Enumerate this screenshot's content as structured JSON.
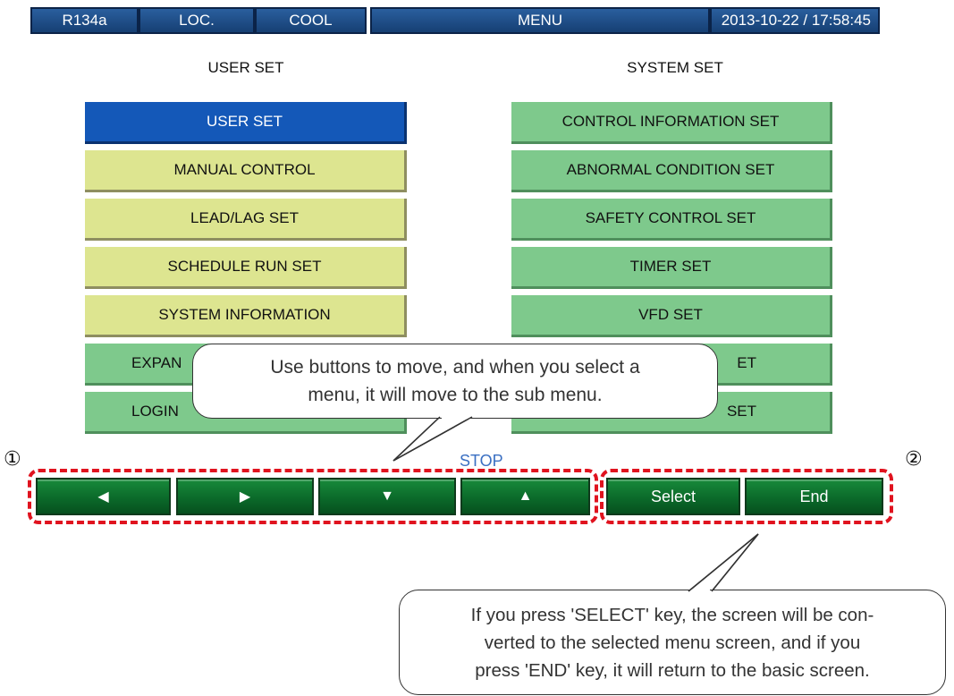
{
  "header": {
    "refrigerant": "R134a",
    "location": "LOC.",
    "mode": "COOL",
    "screen": "MENU",
    "datetime": "2013-10-22 / 17:58:45"
  },
  "user_set": {
    "title": "USER SET",
    "items": [
      {
        "label": "USER SET"
      },
      {
        "label": "MANUAL CONTROL"
      },
      {
        "label": "LEAD/LAG SET"
      },
      {
        "label": "SCHEDULE RUN SET"
      },
      {
        "label": "SYSTEM INFORMATION"
      },
      {
        "label": "EXPAN"
      },
      {
        "label": "LOGIN"
      }
    ]
  },
  "system_set": {
    "title": "SYSTEM SET",
    "items": [
      {
        "label": "CONTROL INFORMATION SET"
      },
      {
        "label": "ABNORMAL CONDITION SET"
      },
      {
        "label": "SAFETY CONTROL SET"
      },
      {
        "label": "TIMER SET"
      },
      {
        "label": "VFD SET"
      },
      {
        "label": "ET"
      },
      {
        "label": "SET"
      }
    ]
  },
  "status": "STOP",
  "keys": {
    "left": "◀",
    "right": "▶",
    "down": "▼",
    "up": "▲",
    "select": "Select",
    "end": "End"
  },
  "markers": {
    "one": "①",
    "two": "②"
  },
  "callouts": {
    "nav": {
      "line1": "Use buttons to move, and when you select a",
      "line2": "menu, it will move to the sub menu."
    },
    "select": {
      "line1": "If you press 'SELECT' key, the screen will be con-",
      "line2": "verted to the selected menu screen, and if you",
      "line3": "press 'END' key, it will return to the basic screen."
    }
  },
  "colors": {
    "header_blue": "#1f4f8c",
    "selected_blue": "#1458b8",
    "user_yellow": "#dde590",
    "system_green": "#7ec98c",
    "key_green": "#0b6a2a",
    "dash_red": "#e0131f",
    "status_blue": "#3a6fc2"
  }
}
